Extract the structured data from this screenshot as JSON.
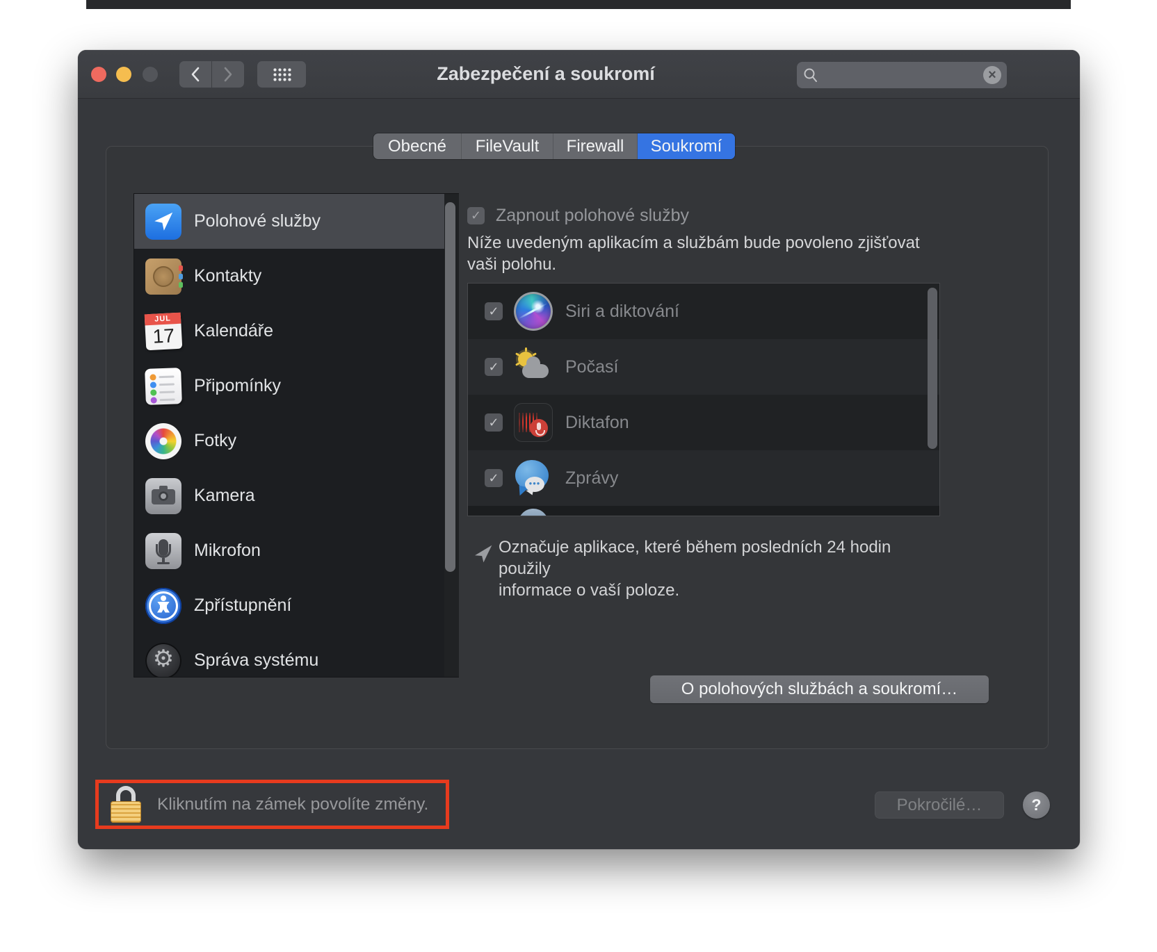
{
  "window": {
    "title": "Zabezpečení a soukromí"
  },
  "titlebar": {
    "search": {
      "value": "",
      "placeholder": ""
    }
  },
  "tabs": [
    {
      "label": "Obecné",
      "selected": false
    },
    {
      "label": "FileVault",
      "selected": false
    },
    {
      "label": "Firewall",
      "selected": false
    },
    {
      "label": "Soukromí",
      "selected": true
    }
  ],
  "sidebar": {
    "items": [
      {
        "label": "Polohové služby",
        "icon": "location-arrow-icon",
        "selected": true
      },
      {
        "label": "Kontakty",
        "icon": "contacts-icon",
        "selected": false
      },
      {
        "label": "Kalendáře",
        "icon": "calendar-icon",
        "selected": false,
        "icon_month": "JUL",
        "icon_day": "17"
      },
      {
        "label": "Připomínky",
        "icon": "reminders-icon",
        "selected": false
      },
      {
        "label": "Fotky",
        "icon": "photos-icon",
        "selected": false
      },
      {
        "label": "Kamera",
        "icon": "camera-icon",
        "selected": false
      },
      {
        "label": "Mikrofon",
        "icon": "microphone-icon",
        "selected": false
      },
      {
        "label": "Zpřístupnění",
        "icon": "accessibility-icon",
        "selected": false
      },
      {
        "label": "Správa systému",
        "icon": "system-gear-icon",
        "selected": false
      }
    ]
  },
  "privacy": {
    "enable_checkbox": {
      "label": "Zapnout polohové služby",
      "checked": true,
      "enabled": false
    },
    "description": {
      "line1": "Níže uvedeným aplikacím a službám bude povoleno zjišťovat",
      "line2": "vaši polohu."
    },
    "apps": [
      {
        "name": "Siri a diktování",
        "checked": true,
        "icon": "siri-icon"
      },
      {
        "name": "Počasí",
        "checked": true,
        "icon": "weather-icon"
      },
      {
        "name": "Diktafon",
        "checked": true,
        "icon": "voice-memos-icon"
      },
      {
        "name": "Zprávy",
        "checked": true,
        "icon": "messages-icon"
      }
    ],
    "note": {
      "line1": "Označuje aplikace, které během posledních 24 hodin použily",
      "line2": "informace o vaší poloze."
    },
    "about_button": "O polohových službách a soukromí…"
  },
  "footer": {
    "lock_text": "Kliknutím na zámek povolíte změny.",
    "advanced_button": "Pokročilé…",
    "help_button": "?"
  },
  "colors": {
    "accent_blue": "#3574e2",
    "annotation_red": "#e73b1e",
    "traffic_red": "#ee6a5f",
    "traffic_yellow": "#f5bd4f",
    "traffic_inactive": "#53555a"
  }
}
